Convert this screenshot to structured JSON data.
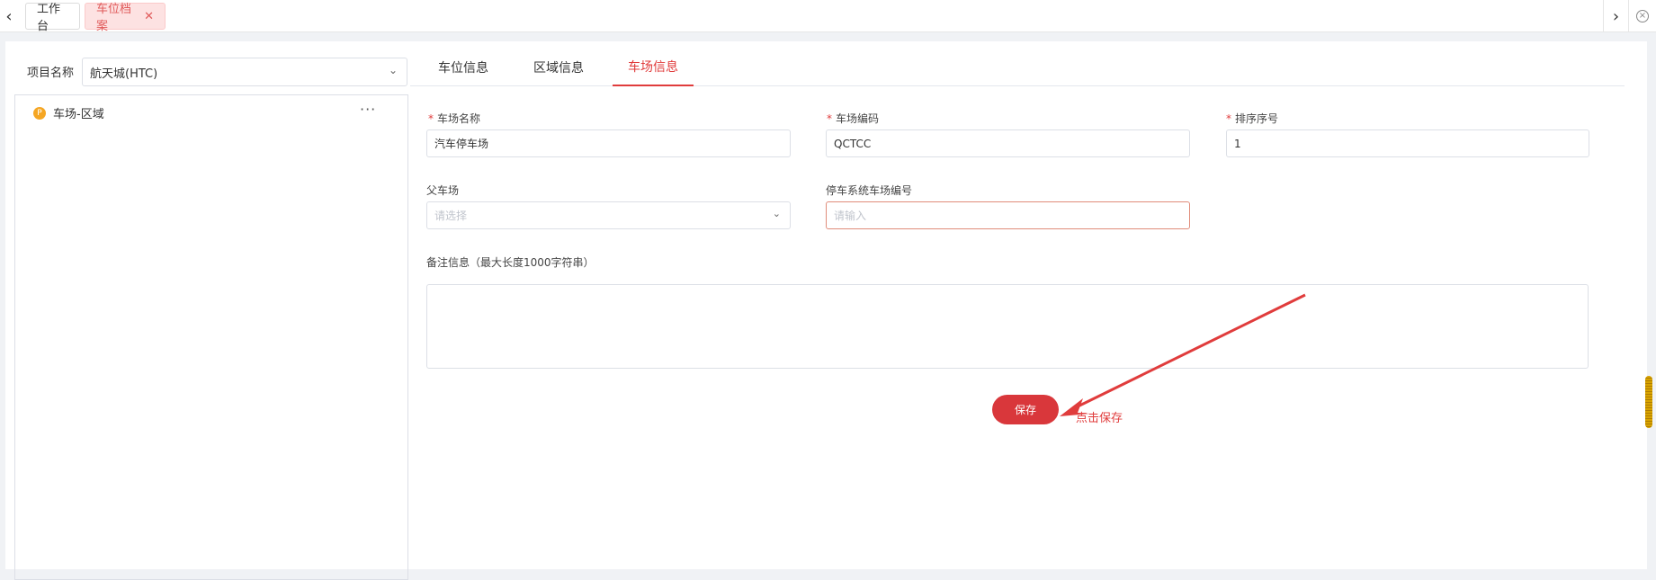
{
  "topbar": {
    "tabs": [
      {
        "label": "工作台"
      },
      {
        "label": "车位档案",
        "close": "✕"
      }
    ]
  },
  "left": {
    "project_label": "项目名称",
    "project_value": "航天城(HTC)",
    "tree_item": "车场-区域",
    "tree_more": "···"
  },
  "tabs": {
    "items": [
      {
        "label": "车位信息"
      },
      {
        "label": "区域信息"
      },
      {
        "label": "车场信息"
      }
    ],
    "active": "车场信息"
  },
  "form": {
    "lot_name_label": "车场名称",
    "lot_name_value": "汽车停车场",
    "lot_code_label": "车场编码",
    "lot_code_value": "QCTCC",
    "sort_label": "排序序号",
    "sort_value": "1",
    "parent_label": "父车场",
    "parent_placeholder": "请选择",
    "system_code_label": "停车系统车场编号",
    "system_code_placeholder": "请输入",
    "remark_label": "备注信息（最大长度1000字符串）",
    "required_mark": "*"
  },
  "actions": {
    "save_label": "保存",
    "hint": "点击保存"
  },
  "colors": {
    "accent": "#e03c3c",
    "save_button": "#d9373b",
    "tab_active_bg": "#fde2e2"
  },
  "icons": {
    "nav_left": "chevron-left-icon",
    "nav_right": "chevron-right-icon",
    "close_all": "close-circle-icon",
    "select_chevron": "chevron-down-icon",
    "tree_node": "parking-icon",
    "annotation_arrow": "arrow-icon"
  }
}
